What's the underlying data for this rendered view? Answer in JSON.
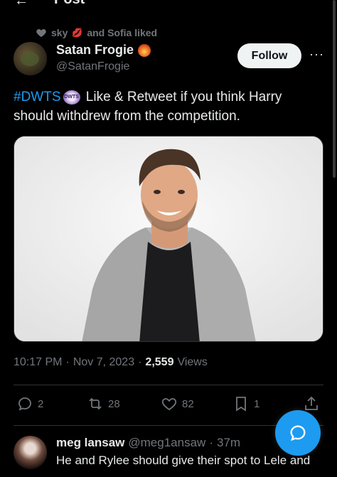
{
  "header": {
    "back_icon": "back-arrow-icon",
    "title": "Post"
  },
  "liked_by": {
    "icon": "heart-icon",
    "prefix": "sky",
    "emoji": "lips-emoji",
    "suffix": "and Sofia liked"
  },
  "author": {
    "display_name": "Satan Frogie",
    "badge": "fire-emoji",
    "handle": "@SatanFrogie"
  },
  "follow_label": "Follow",
  "more_icon": "more-icon",
  "more_text": "···",
  "tweet": {
    "hashtag": "#DWTS",
    "dwts_logo_text": "DWTS",
    "text_line1": " Like & Retweet if you think Harry",
    "text_line2": "should withdrew from the competition."
  },
  "meta": {
    "time": "10:17 PM",
    "sep1": "·",
    "date": "Nov 7, 2023",
    "sep2": "·",
    "views_count": "2,559",
    "views_label": "Views"
  },
  "actions": {
    "replies": "2",
    "reposts": "28",
    "likes": "82",
    "bookmarks": "1"
  },
  "reply": {
    "name": "meg lansaw",
    "handle": "@meg1ansaw",
    "sep": "·",
    "time": "37m",
    "text": "He and Rylee should give their spot to Lele and"
  },
  "colors": {
    "accent": "#1d9bf0",
    "muted": "#71767b",
    "text": "#e7e9ea",
    "background": "#000000"
  }
}
